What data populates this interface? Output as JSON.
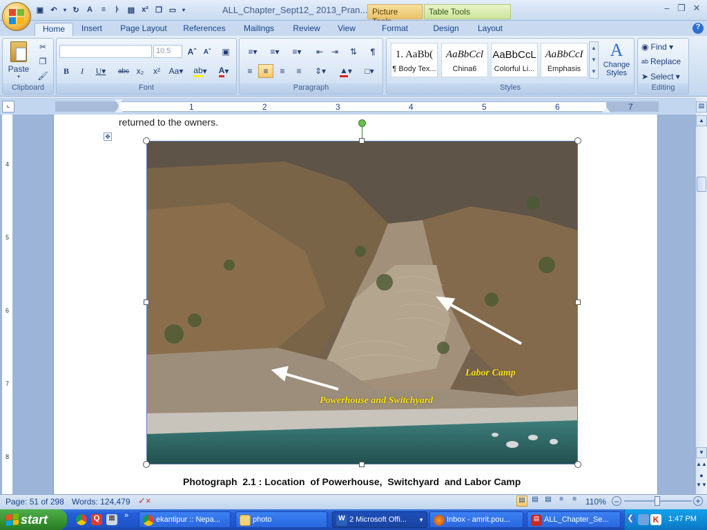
{
  "window": {
    "title": "ALL_Chapter_Sept12_ 2013_Pran...",
    "context_tabs": [
      "Picture Tools",
      "Table Tools"
    ]
  },
  "tabs": [
    "Home",
    "Insert",
    "Page Layout",
    "References",
    "Mailings",
    "Review",
    "View",
    "Format",
    "Design",
    "Layout"
  ],
  "ribbon": {
    "clipboard": {
      "label": "Clipboard",
      "paste": "Paste"
    },
    "font": {
      "label": "Font",
      "font_name": "",
      "font_size": "10.5"
    },
    "paragraph": {
      "label": "Paragraph"
    },
    "styles": {
      "label": "Styles",
      "items": [
        {
          "preview": "1. AaBb(",
          "name": "¶ Body Tex..."
        },
        {
          "preview": "AaBbCcl",
          "name": "China6"
        },
        {
          "preview": "AaBbCcL",
          "name": "Colorful Li..."
        },
        {
          "preview": "AaBbCcI",
          "name": "Emphasis"
        }
      ],
      "change_styles": "Change Styles"
    },
    "editing": {
      "label": "Editing",
      "find": "Find",
      "replace": "Replace",
      "select": "Select"
    }
  },
  "ruler": {
    "numbers": [
      "1",
      "2",
      "3",
      "4",
      "5",
      "6",
      "7"
    ]
  },
  "vruler": {
    "numbers": [
      "4",
      "5",
      "6",
      "7",
      "8"
    ]
  },
  "document": {
    "text_top": "returned  to  the  owners.",
    "photo_labels": {
      "labor_camp": "Labor Camp",
      "powerhouse": "Powerhouse and Switchyard"
    },
    "caption": "Photograph  2.1 : Location  of Powerhouse,  Switchyard  and Labor Camp"
  },
  "status": {
    "page": "Page: 51 of 298",
    "words": "Words: 124,479",
    "zoom": "110%"
  },
  "taskbar": {
    "start": "start",
    "tasks": [
      {
        "label": "ekantipur :: Nepa..."
      },
      {
        "label": "photo"
      },
      {
        "label": "2 Microsoft Offi..."
      },
      {
        "label": "Inbox - amrit.pou..."
      },
      {
        "label": "ALL_Chapter_Se..."
      }
    ],
    "clock": "1:47 PM"
  },
  "colors": {
    "label_yellow": "#f5e21e",
    "word_blue": "#15428b",
    "taskbar_blue": "#245edb"
  }
}
